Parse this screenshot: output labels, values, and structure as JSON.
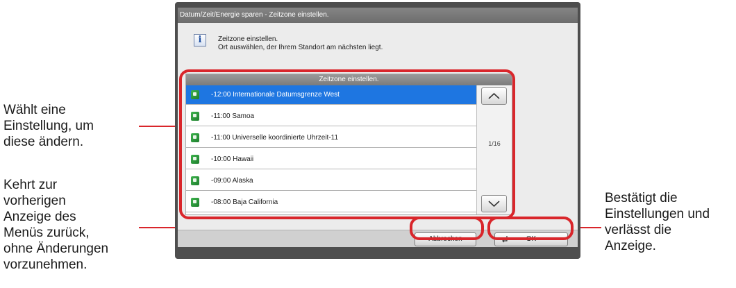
{
  "annotations": {
    "left_top": "Wählt eine\nEinstellung, um\ndiese ändern.",
    "left_bottom": "Kehrt zur\nvorherigen\nAnzeige des\nMenüs zurück,\nohne Änderungen\nvorzunehmen.",
    "right": "Bestätigt die\nEinstellungen und\nverlässt die\nAnzeige."
  },
  "window": {
    "title": "Datum/Zeit/Energie sparen - Zeitzone einstellen.",
    "info_glyph": "i",
    "message_line1": "Zeitzone einstellen.",
    "message_line2": "Ort auswählen, der Ihrem Standort am nächsten liegt."
  },
  "list": {
    "header": "Zeitzone einstellen.",
    "items": [
      {
        "label": "-12:00 Internationale Datumsgrenze West",
        "selected": true
      },
      {
        "label": "-11:00 Samoa",
        "selected": false
      },
      {
        "label": "-11:00 Universelle koordinierte Uhrzeit-11",
        "selected": false
      },
      {
        "label": "-10:00 Hawaii",
        "selected": false
      },
      {
        "label": "-09:00 Alaska",
        "selected": false
      },
      {
        "label": "-08:00 Baja California",
        "selected": false
      }
    ],
    "page_indicator": "1/16",
    "scroll_up_icon": "chevron-up-icon",
    "scroll_down_icon": "chevron-down-icon"
  },
  "buttons": {
    "cancel_label": "Abbrechen",
    "ok_label": "OK",
    "ok_icon": "enter-icon"
  },
  "colors": {
    "accent_red": "#d9262b",
    "selected_blue": "#1e76e1",
    "tz_icon_green": "#2e9b3f"
  }
}
